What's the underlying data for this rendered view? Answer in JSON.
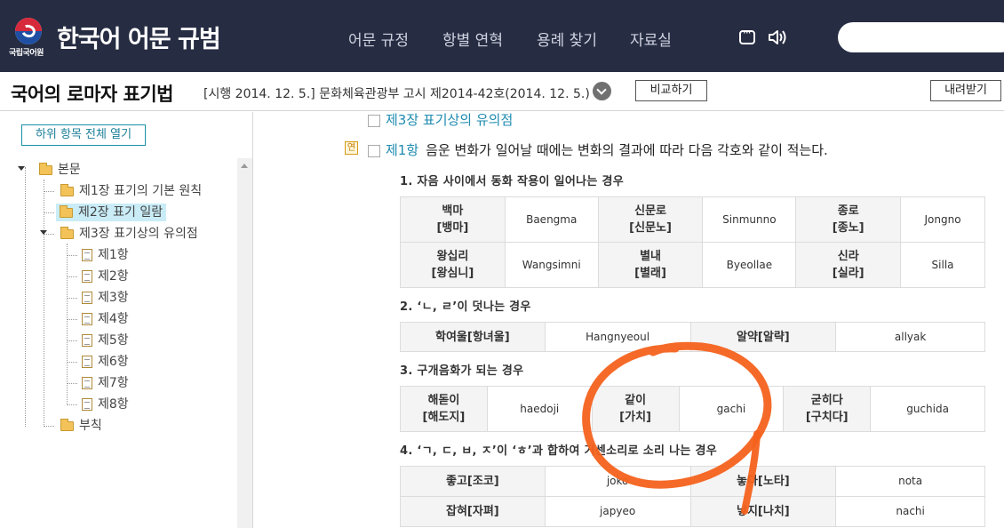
{
  "header": {
    "org_name": "국립국어원",
    "site_title": "한국어 어문 규범",
    "nav": [
      "어문 규정",
      "항별 연혁",
      "용례 찾기",
      "자료실"
    ],
    "icons": [
      "chat-icon",
      "speaker-icon"
    ],
    "search_placeholder": ""
  },
  "titlebar": {
    "title": "국어의 로마자 표기법",
    "meta": "[시행 2014. 12. 5.] 문화체육관광부 고시 제2014-42호(2014. 12. 5.)",
    "compare_label": "비교하기",
    "download_label": "내려받기"
  },
  "sidebar": {
    "expand_all_label": "하위 항목 전체 열기",
    "tree": {
      "root": "본문",
      "ch1": "제1장 표기의 기본 원칙",
      "ch2": "제2장 표기 일람",
      "ch3": "제3장 표기상의 유의점",
      "clauses": [
        "제1항",
        "제2항",
        "제3항",
        "제4항",
        "제5항",
        "제6항",
        "제7항",
        "제8항"
      ],
      "appendix": "부칙"
    }
  },
  "main": {
    "chapter": "제3장 표기상의 유의점",
    "yeon_badge": "연",
    "clause_number": "제1항",
    "clause_text": "음운 변화가 일어날 때에는 변화의 결과에 따라 다음 각호와 같이 적는다.",
    "sections": [
      {
        "heading": "1. 자음 사이에서 동화 작용이 일어나는 경우",
        "rows": [
          [
            [
              "백마",
              "[뱅마]"
            ],
            "Baengma",
            [
              "신문로",
              "[신문노]"
            ],
            "Sinmunno",
            [
              "종로",
              "[종노]"
            ],
            "Jongno"
          ],
          [
            [
              "왕십리",
              "[왕심니]"
            ],
            "Wangsimni",
            [
              "별내",
              "[별래]"
            ],
            "Byeollae",
            [
              "신라",
              "[실라]"
            ],
            "Silla"
          ]
        ]
      },
      {
        "heading": "2. ‘ㄴ, ㄹ’이 덧나는 경우",
        "rows": [
          [
            "학여울[항녀울]",
            "Hangnyeoul",
            "알약[알략]",
            "allyak"
          ]
        ]
      },
      {
        "heading": "3. 구개음화가 되는 경우",
        "rows": [
          [
            [
              "해돋이",
              "[해도지]"
            ],
            "haedoji",
            [
              "같이",
              "[가치]"
            ],
            "gachi",
            [
              "굳히다",
              "[구치다]"
            ],
            "guchida"
          ]
        ]
      },
      {
        "heading": "4. ‘ㄱ, ㄷ, ㅂ, ㅈ’이 ‘ㅎ’과 합하여 거센소리로 소리 나는 경우",
        "rows": [
          [
            "좋고[조코]",
            "joko",
            "놓다[노타]",
            "nota"
          ],
          [
            "잡혀[자펴]",
            "japyeo",
            "낳지[나치]",
            "nachi"
          ]
        ]
      }
    ]
  },
  "colors": {
    "header_bg": "#262c42",
    "accent_link": "#1e8bb0",
    "annotation": "#f4621c",
    "selected_bg": "#c9ecf7"
  }
}
